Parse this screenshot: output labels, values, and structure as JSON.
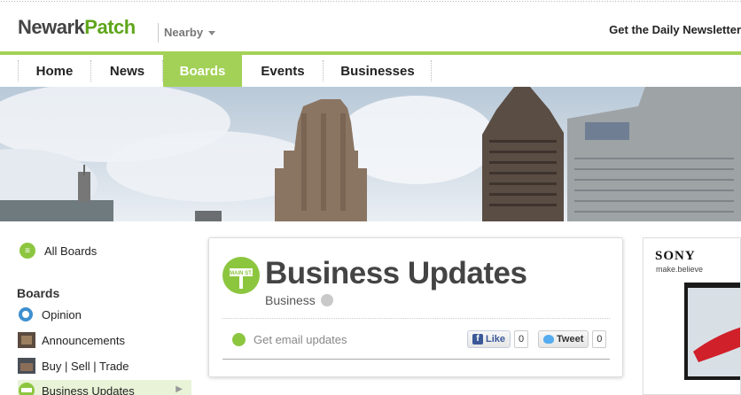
{
  "header": {
    "logo_city": "Newark",
    "logo_patch": "Patch",
    "nearby_label": "Nearby",
    "newsletter_label": "Get the Daily Newsletter"
  },
  "nav": {
    "items": [
      {
        "label": "Home"
      },
      {
        "label": "News"
      },
      {
        "label": "Boards",
        "active": true
      },
      {
        "label": "Events"
      },
      {
        "label": "Businesses"
      }
    ]
  },
  "sidebar": {
    "all_boards_label": "All Boards",
    "heading": "Boards",
    "items": [
      {
        "label": "Opinion",
        "icon": "info-icon"
      },
      {
        "label": "Announcements",
        "icon": "announcements-thumb-icon"
      },
      {
        "label": "Buy | Sell | Trade",
        "icon": "trade-thumb-icon"
      },
      {
        "label": "Business Updates",
        "icon": "main-st-sign-icon",
        "active": true
      }
    ]
  },
  "board": {
    "sign_text": "MAIN ST.",
    "title": "Business Updates",
    "category": "Business",
    "email_label": "Get email updates",
    "like_label": "Like",
    "like_count": "0",
    "tweet_label": "Tweet",
    "tweet_count": "0"
  },
  "ad": {
    "brand": "SONY",
    "tagline": "make.believe"
  },
  "colors": {
    "accent_green": "#a3d157",
    "logo_green": "#5fa61c",
    "facebook_blue": "#3b5998",
    "twitter_blue": "#55acee"
  }
}
